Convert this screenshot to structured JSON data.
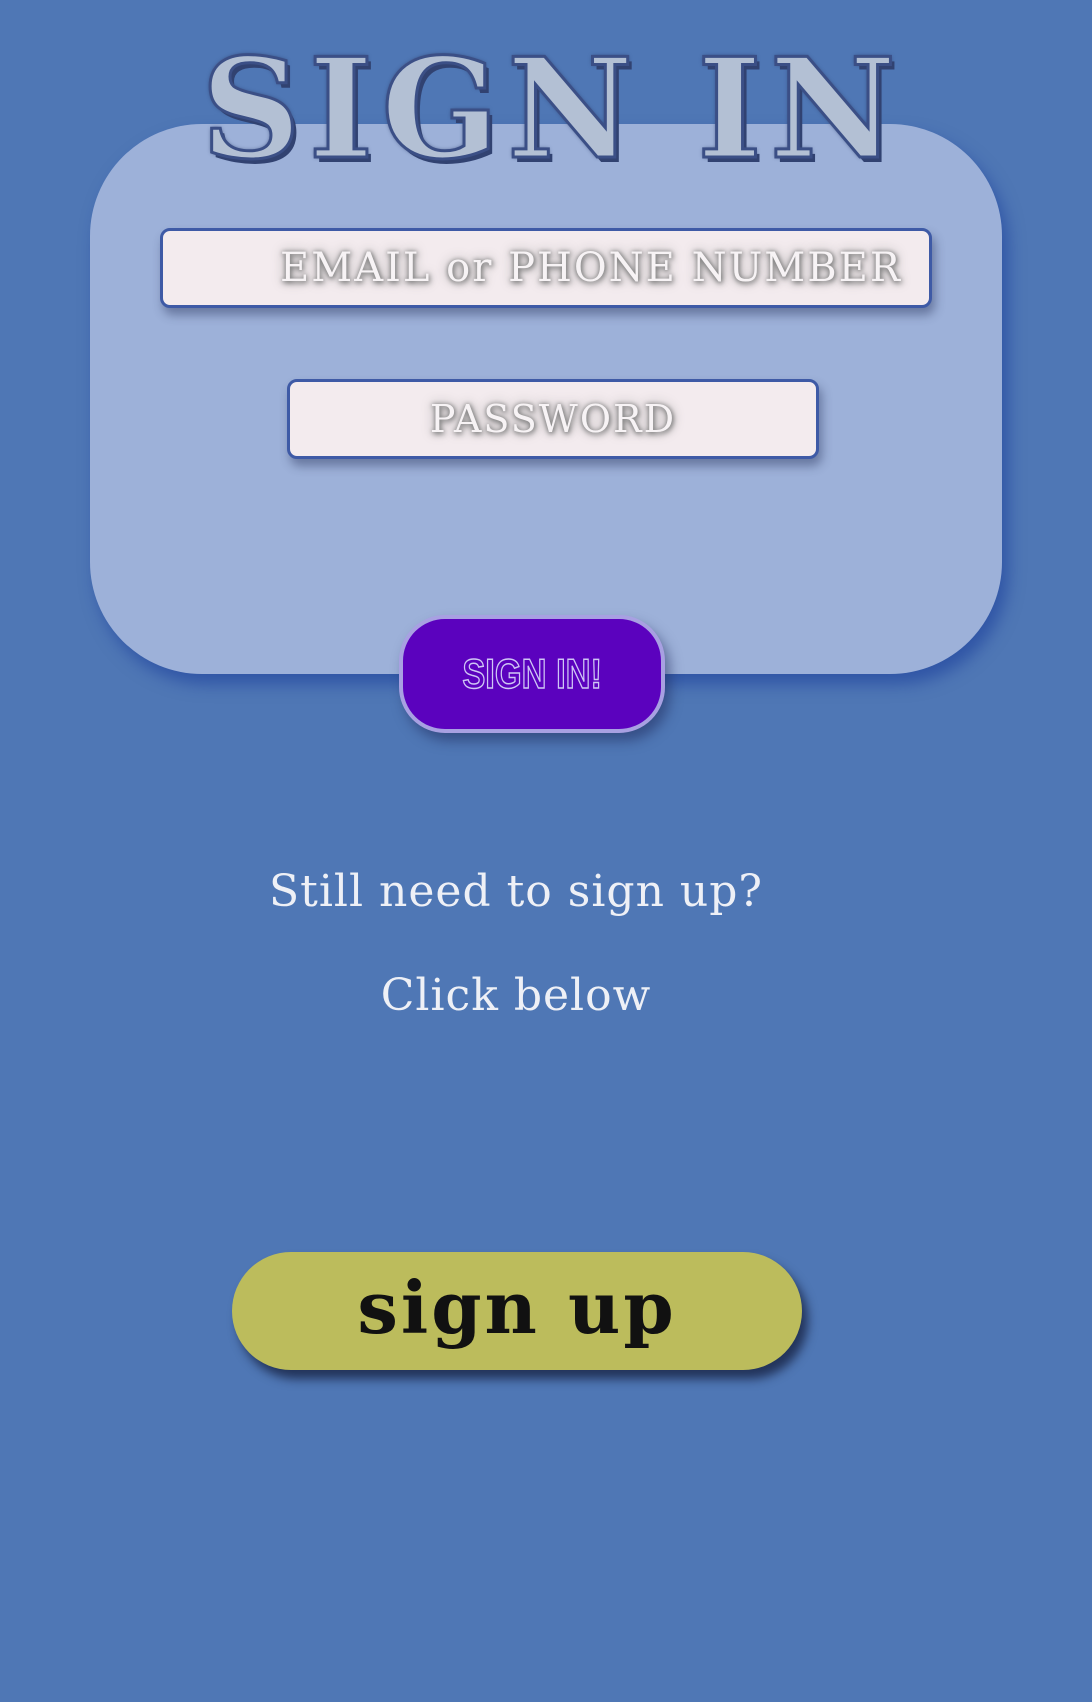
{
  "header": {
    "title": "SIGN IN"
  },
  "form": {
    "email_placeholder": "EMAIL or PHONE NUMBER",
    "password_placeholder": "PASSWORD",
    "submit_label": "SIGN IN!"
  },
  "signup_prompt": {
    "line1": "Still need to sign up?",
    "line2": "Click below",
    "button_label": "sign up"
  },
  "colors": {
    "background": "#4f77b5",
    "card": "#9db1d9",
    "submit_button": "#5b02be",
    "signup_button": "#bcbc5c",
    "field": "#f3ebee"
  }
}
